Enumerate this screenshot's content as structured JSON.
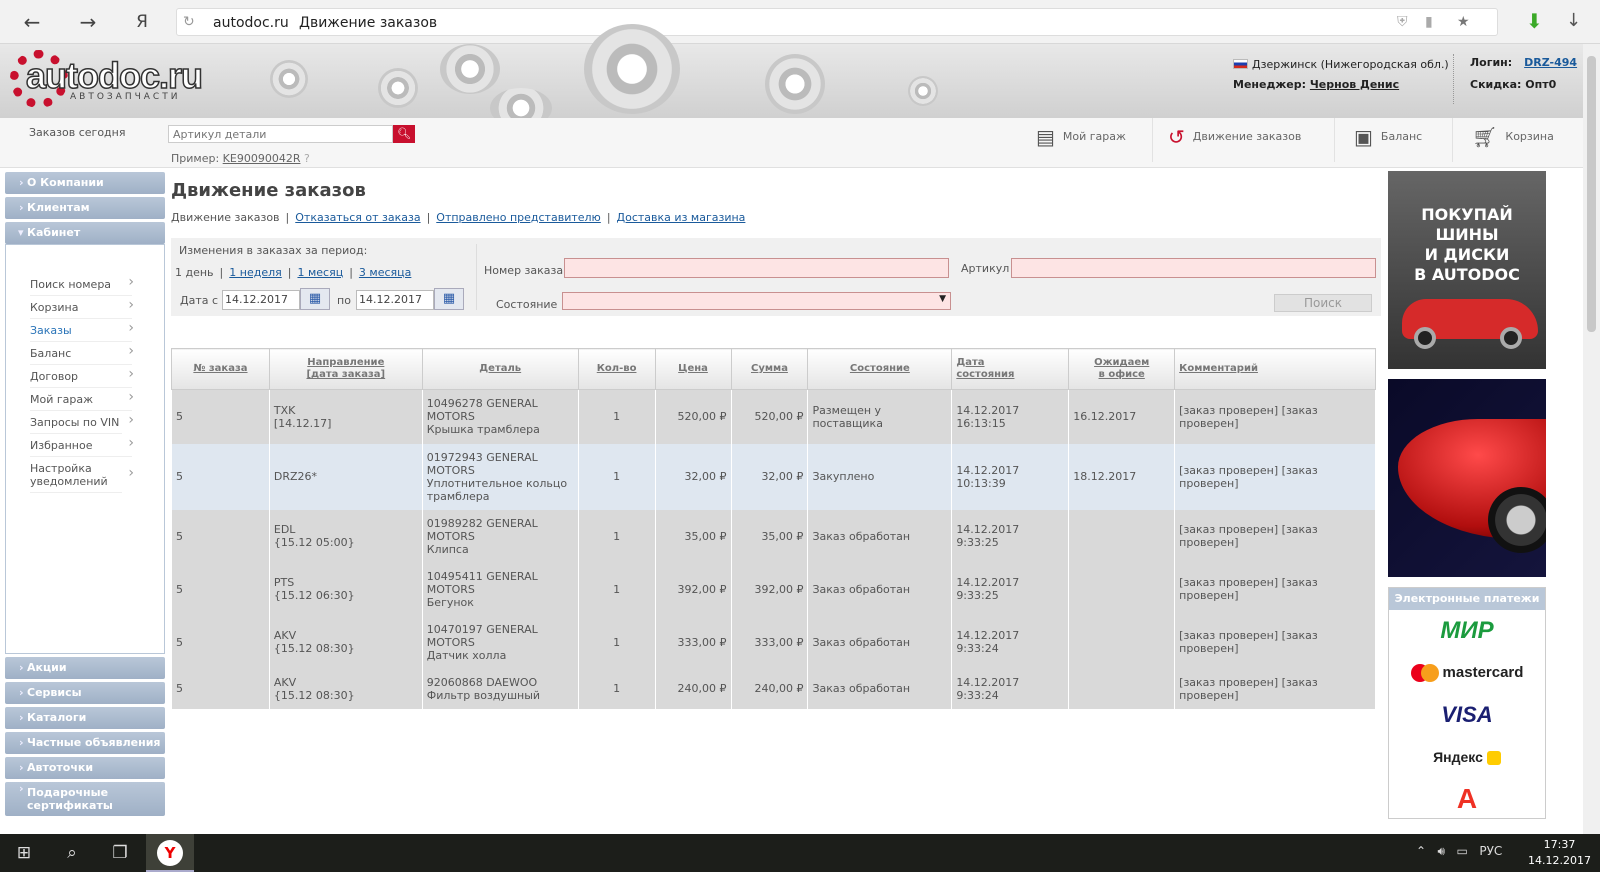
{
  "browser": {
    "back": "←",
    "forward": "→",
    "yandex_btn": "Я",
    "reload": "↻",
    "host": "autodoc.ru",
    "title": "Движение заказов",
    "bookmark": "★",
    "download_green": "⬇",
    "download": "↓"
  },
  "header": {
    "logo_text": "autodoc.ru",
    "logo_sub": "АВТОЗАПЧАСТИ",
    "city": "Дзержинск (Нижегородская обл.)",
    "manager_label": "Менеджер:",
    "manager_name": "Чернов Денис",
    "login_label": "Логин:",
    "login_value": "DRZ-494",
    "discount": "Скидка: Опт0"
  },
  "subbar": {
    "orders_today": "Заказов сегодня",
    "search_placeholder": "Артикул детали",
    "example_label": "Пример:",
    "example_value": "KE90090042R",
    "nav": [
      {
        "label": "Мой гараж",
        "icon": "garage-icon"
      },
      {
        "label": "Движение заказов",
        "icon": "order-movement-icon"
      },
      {
        "label": "Баланс",
        "icon": "wallet-icon"
      },
      {
        "label": "Корзина",
        "icon": "cart-icon"
      }
    ]
  },
  "sidebar": {
    "sections_top": [
      "О Компании",
      "Клиентам"
    ],
    "cabinet": "Кабинет",
    "cabinet_items": [
      "Поиск номера",
      "Корзина",
      "Заказы",
      "Баланс",
      "Договор",
      "Мой гараж",
      "Запросы по VIN",
      "Избранное",
      "Настройка уведомлений"
    ],
    "active_item": "Заказы",
    "sections_bottom": [
      "Акции",
      "Сервисы",
      "Каталоги",
      "Частные объявления",
      "Автоточки",
      "Подарочные сертификаты"
    ]
  },
  "main": {
    "title": "Движение заказов",
    "tabs": [
      "Движение заказов",
      "Отказаться от заказа",
      "Отправлено представителю",
      "Доставка из магазина"
    ],
    "filters": {
      "period_label": "Изменения в заказах за период:",
      "periods": [
        "1 день",
        "1 неделя",
        "1 месяц",
        "3 месяца"
      ],
      "date_from_label": "Дата с",
      "date_from": "14.12.2017",
      "date_to_label": "по",
      "date_to": "14.12.2017",
      "order_no_label": "Номер заказа",
      "article_label": "Артикул",
      "state_label": "Состояние",
      "search_button": "Поиск"
    },
    "table": {
      "headers": [
        "№ заказа",
        "Направление\n[дата заказа]",
        "Деталь",
        "Кол-во",
        "Цена",
        "Сумма",
        "Состояние",
        "Дата\nсостояния",
        "Ожидаем\nв офисе",
        "Комментарий"
      ],
      "rows": [
        {
          "order": "5",
          "direction": "TXK\n[14.12.17]",
          "detail": "10496278 GENERAL\nMOTORS\nКрышка трамблера",
          "qty": "1",
          "price": "520,00 ₽",
          "sum": "520,00 ₽",
          "state": "Размещен у поставщика",
          "state_date": "14.12.2017\n16:13:15",
          "expected": "16.12.2017",
          "comment": "[заказ проверен] [заказ проверен]",
          "highlight": false
        },
        {
          "order": "5",
          "direction": "DRZ26*",
          "detail": "01972943 GENERAL\nMOTORS\nУплотнительное кольцо\nтрамблера",
          "qty": "1",
          "price": "32,00 ₽",
          "sum": "32,00 ₽",
          "state": "Закуплено",
          "state_date": "14.12.2017\n10:13:39",
          "expected": "18.12.2017",
          "comment": "[заказ проверен] [заказ проверен]",
          "highlight": true
        },
        {
          "order": "5",
          "direction": "EDL\n{15.12 05:00}",
          "detail": "01989282 GENERAL\nMOTORS\nКлипса",
          "qty": "1",
          "price": "35,00 ₽",
          "sum": "35,00 ₽",
          "state": "Заказ обработан",
          "state_date": "14.12.2017\n9:33:25",
          "expected": "",
          "comment": "[заказ проверен] [заказ проверен]",
          "highlight": false
        },
        {
          "order": "5",
          "direction": "PTS\n{15.12 06:30}",
          "detail": "10495411 GENERAL\nMOTORS\nБегунок",
          "qty": "1",
          "price": "392,00 ₽",
          "sum": "392,00 ₽",
          "state": "Заказ обработан",
          "state_date": "14.12.2017\n9:33:25",
          "expected": "",
          "comment": "[заказ проверен] [заказ проверен]",
          "highlight": false
        },
        {
          "order": "5",
          "direction": "AKV\n{15.12 08:30}",
          "detail": "10470197 GENERAL\nMOTORS\nДатчик холла",
          "qty": "1",
          "price": "333,00 ₽",
          "sum": "333,00 ₽",
          "state": "Заказ обработан",
          "state_date": "14.12.2017\n9:33:24",
          "expected": "",
          "comment": "[заказ проверен] [заказ проверен]",
          "highlight": false
        },
        {
          "order": "5",
          "direction": "AKV\n{15.12 08:30}",
          "detail": "92060868 DAEWOO\nФильтр воздушный",
          "qty": "1",
          "price": "240,00 ₽",
          "sum": "240,00 ₽",
          "state": "Заказ обработан",
          "state_date": "14.12.2017\n9:33:24",
          "expected": "",
          "comment": "[заказ проверен] [заказ проверен]",
          "highlight": false
        }
      ]
    }
  },
  "right": {
    "ad1_text": "ПОКУПАЙ\nШИНЫ\nИ ДИСКИ\nВ AUTODOC",
    "payments_title": "Электронные платежи",
    "payment_logos": [
      "МИР",
      "mastercard",
      "VISA",
      "Яндекс",
      "А"
    ]
  },
  "taskbar": {
    "lang": "РУС",
    "time": "17:37",
    "date": "14.12.2017"
  }
}
